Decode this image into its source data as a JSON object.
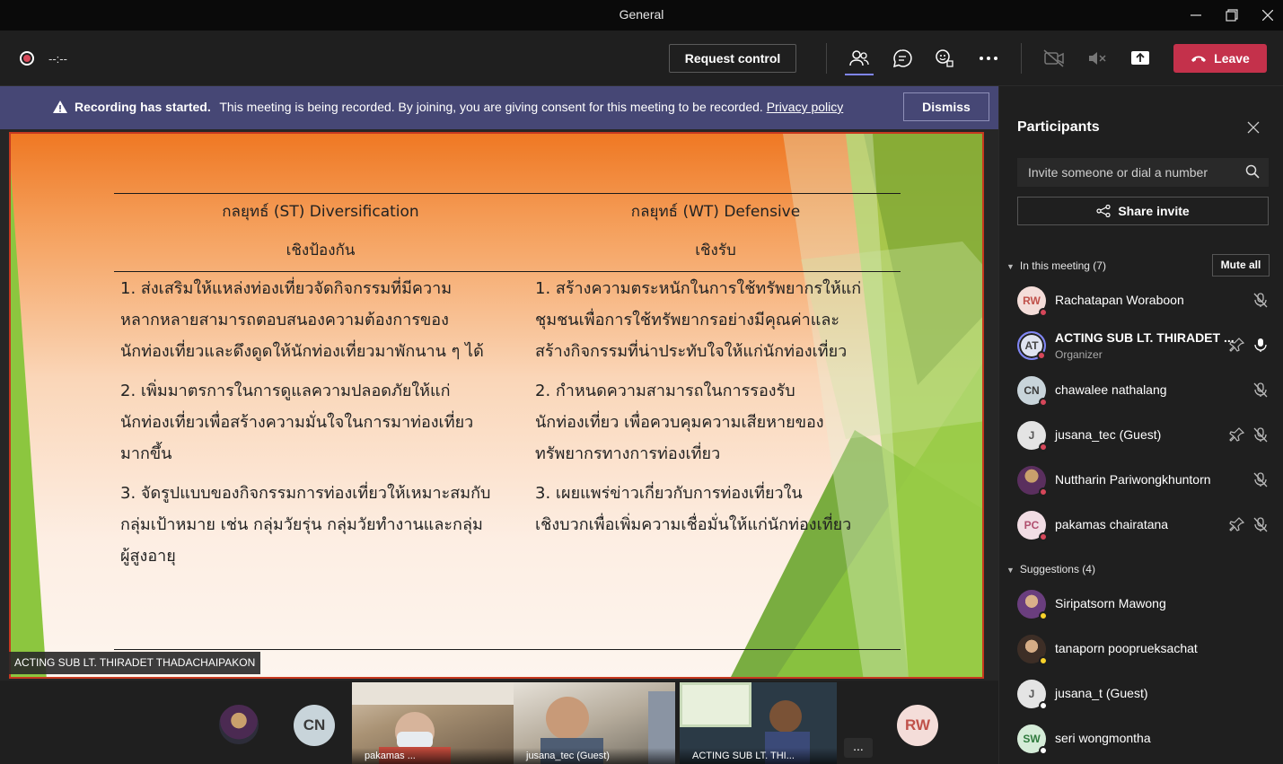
{
  "window": {
    "title": "General"
  },
  "toolbar": {
    "timer": "--:--",
    "request_control": "Request control",
    "leave": "Leave"
  },
  "banner": {
    "bold": "Recording has started.",
    "text": "This meeting is being recorded. By joining, you are giving consent for this meeting to be recorded.",
    "link": "Privacy policy",
    "dismiss": "Dismiss"
  },
  "slide": {
    "col1_title": "กลยุทธ์ (ST) Diversification",
    "col1_sub": "เชิงป้องกัน",
    "col2_title": "กลยุทธ์ (WT) Defensive",
    "col2_sub": "เชิงรับ",
    "col1_items": [
      [
        "1. ส่งเสริมให้แหล่งท่องเที่ยวจัดกิจกรรมที่มีความ",
        "หลากหลายสามารถตอบสนองความต้องการของ",
        "นักท่องเที่ยวและดึงดูดให้นักท่องเที่ยวมาพักนาน ๆ ได้"
      ],
      [
        "2. เพิ่มมาตรการในการดูแลความปลอดภัยให้แก่",
        "นักท่องเที่ยวเพื่อสร้างความมั่นใจในการมาท่องเที่ยว",
        "มากขึ้น"
      ],
      [
        "3. จัดรูปแบบของกิจกรรมการท่องเที่ยวให้เหมาะสมกับ",
        "กลุ่มเป้าหมาย เช่น กลุ่มวัยรุ่น กลุ่มวัยทำงานและกลุ่ม",
        "ผู้สูงอายุ"
      ]
    ],
    "col2_items": [
      [
        "1. สร้างความตระหนักในการใช้ทรัพยากรให้แก่",
        "ชุมชนเพื่อการใช้ทรัพยากรอย่างมีคุณค่าและ",
        "สร้างกิจกรรมที่น่าประทับใจให้แก่นักท่องเที่ยว"
      ],
      [
        "2. กำหนดความสามารถในการรองรับ",
        "นักท่องเที่ยว เพื่อควบคุมความเสียหายของ",
        "ทรัพยากรทางการท่องเที่ยว"
      ],
      [
        "3. เผยแพร่ข่าวเกี่ยวกับการท่องเที่ยวใน",
        "เชิงบวกเพื่อเพิ่มความเชื่อมั่นให้แก่นักท่องเที่ยว"
      ]
    ],
    "presenter": "ACTING SUB LT. THIRADET THADACHAIPAKON"
  },
  "gallery": {
    "cn": "CN",
    "rw": "RW",
    "tile1": "pakamas ...",
    "tile2": "jusana_tec (Guest)",
    "tile3": "ACTING SUB LT. THI...",
    "more": "..."
  },
  "panel": {
    "title": "Participants",
    "invite_placeholder": "Invite someone or dial a number",
    "share_invite": "Share invite",
    "in_meeting": "In this meeting (7)",
    "mute_all": "Mute all",
    "suggestions": "Suggestions (4)",
    "participants": [
      {
        "initials": "RW",
        "name": "Rachatapan Woraboon"
      },
      {
        "initials": "AT",
        "name": "ACTING SUB LT. THIRADET ...",
        "role": "Organizer"
      },
      {
        "initials": "CN",
        "name": "chawalee nathalang"
      },
      {
        "initials": "J",
        "name": "jusana_tec (Guest)"
      },
      {
        "initials": "",
        "name": "Nuttharin Pariwongkhuntorn"
      },
      {
        "initials": "PC",
        "name": "pakamas chairatana"
      }
    ],
    "suggested": [
      {
        "initials": "",
        "name": "Siripatsorn Mawong"
      },
      {
        "initials": "",
        "name": "tanaporn pooprueksachat"
      },
      {
        "initials": "J",
        "name": "jusana_t (Guest)"
      },
      {
        "initials": "SW",
        "name": "seri wongmontha"
      }
    ]
  },
  "colors": {
    "leave": "#c4314b",
    "banner": "#464775",
    "accent": "#7f85f5",
    "slide_green": "#8cc63f",
    "slide_orange": "#ef7823"
  }
}
